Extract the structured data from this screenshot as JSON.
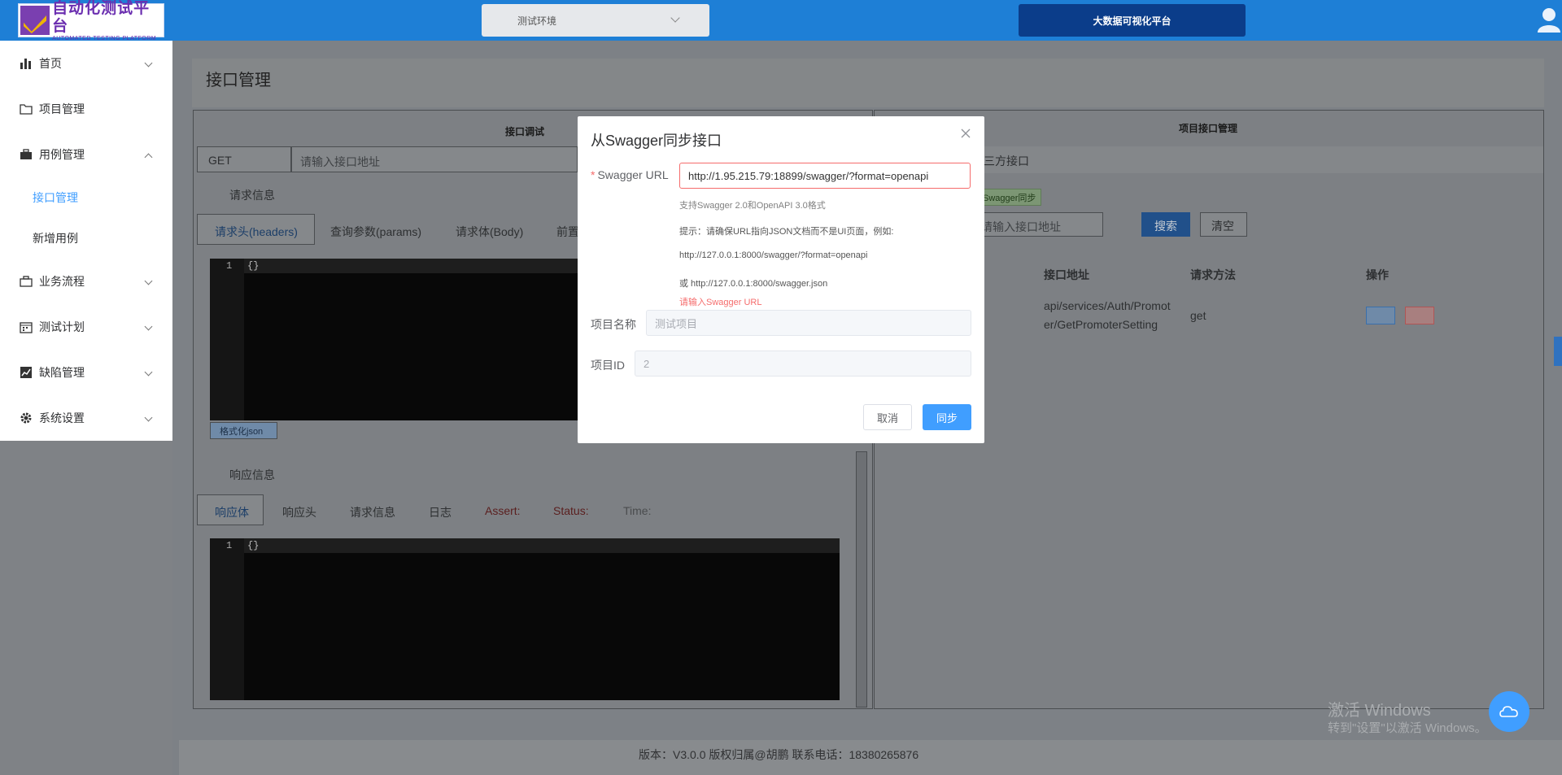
{
  "header": {
    "logo_title": "自动化测试平台",
    "logo_subtitle": "AUTOMATED TESTING PLATFORM",
    "env_select": "测试环境",
    "bigdata_button": "大数据可视化平台"
  },
  "sidebar": {
    "items": [
      {
        "label": "首页"
      },
      {
        "label": "项目管理"
      },
      {
        "label": "用例管理"
      },
      {
        "label": "业务流程"
      },
      {
        "label": "测试计划"
      },
      {
        "label": "缺陷管理"
      },
      {
        "label": "系统设置"
      }
    ],
    "sub_items": [
      {
        "label": "接口管理"
      },
      {
        "label": "新增用例"
      }
    ]
  },
  "page": {
    "title": "接口管理"
  },
  "debug_panel": {
    "title": "接口调试",
    "method": "GET",
    "url_placeholder": "请输入接口地址",
    "request_section": "请求信息",
    "request_tabs": [
      "请求头(headers)",
      "查询参数(params)",
      "请求体(Body)",
      "前置"
    ],
    "editor_line": "1",
    "editor_code": "{}",
    "format_button": "格式化json",
    "response_section": "响应信息",
    "response_tabs": [
      "响应体",
      "响应头",
      "请求信息",
      "日志"
    ],
    "assert_label": "Assert:",
    "status_label": "Status:",
    "time_label": "Time:"
  },
  "project_panel": {
    "title": "项目接口管理",
    "third_party": "三方接口",
    "swagger_sync_tag": "Swagger同步",
    "search_placeholder": "请输入接口地址",
    "search_button": "搜索",
    "clear_button": "清空",
    "columns": [
      "接口地址",
      "请求方法",
      "操作"
    ],
    "rows": [
      {
        "url": "api/services/Auth/PromoterGetPromoterSetting",
        "url_line1": "api/services/Auth/Promot",
        "url_line2": "er/GetPromoterSetting",
        "method": "get"
      }
    ]
  },
  "modal": {
    "title": "从Swagger同步接口",
    "url_label": "Swagger URL",
    "url_value": "http://1.95.215.79:18899/swagger/?format=openapi",
    "hint_support": "支持Swagger 2.0和OpenAPI 3.0格式",
    "hint_tip": "提示：请确保URL指向JSON文档而不是UI页面，例如:",
    "hint_example1": "http://127.0.0.1:8000/swagger/?format=openapi",
    "hint_example2": "或 http://127.0.0.1:8000/swagger.json",
    "error_text": "请输入Swagger URL",
    "project_name_label": "项目名称",
    "project_name_placeholder": "测试项目",
    "project_id_label": "项目ID",
    "project_id_value": "2",
    "cancel_button": "取消",
    "sync_button": "同步"
  },
  "footer": {
    "text": "版本：V3.0.0 版权归属@胡鹏 联系电话：18380265876"
  },
  "watermark": {
    "line1": "激活 Windows",
    "line2": "转到\"设置\"以激活 Windows。"
  }
}
